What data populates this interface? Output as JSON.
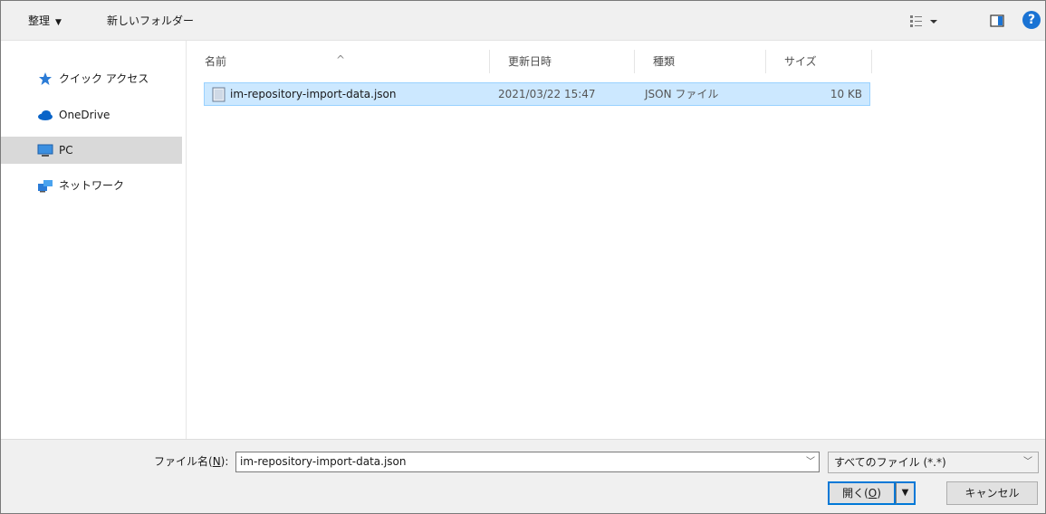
{
  "toolbar": {
    "organize_label": "整理",
    "new_folder_label": "新しいフォルダー",
    "help_label": "?"
  },
  "nav": {
    "items": [
      {
        "label": "クイック アクセス",
        "icon": "star-icon"
      },
      {
        "label": "OneDrive",
        "icon": "cloud-icon"
      },
      {
        "label": "PC",
        "icon": "computer-icon",
        "selected": true
      },
      {
        "label": "ネットワーク",
        "icon": "network-icon"
      }
    ]
  },
  "columns": {
    "name": "名前",
    "date": "更新日時",
    "type": "種類",
    "size": "サイズ"
  },
  "files": [
    {
      "name": "im-repository-import-data.json",
      "date": "2021/03/22 15:47",
      "type": "JSON ファイル",
      "size": "10 KB",
      "selected": true
    }
  ],
  "footer": {
    "filename_label_prefix": "ファイル名(",
    "filename_label_key": "N",
    "filename_label_suffix": "):",
    "filename_value": "im-repository-import-data.json",
    "filter_value": "すべてのファイル (*.*)",
    "open_label_prefix": "開く(",
    "open_label_key": "O",
    "open_label_suffix": ")",
    "cancel_label": "キャンセル"
  },
  "colors": {
    "selection_bg": "#cce8ff",
    "selection_border": "#99d1ff",
    "accent": "#0078d7",
    "help": "#1a73d4"
  }
}
